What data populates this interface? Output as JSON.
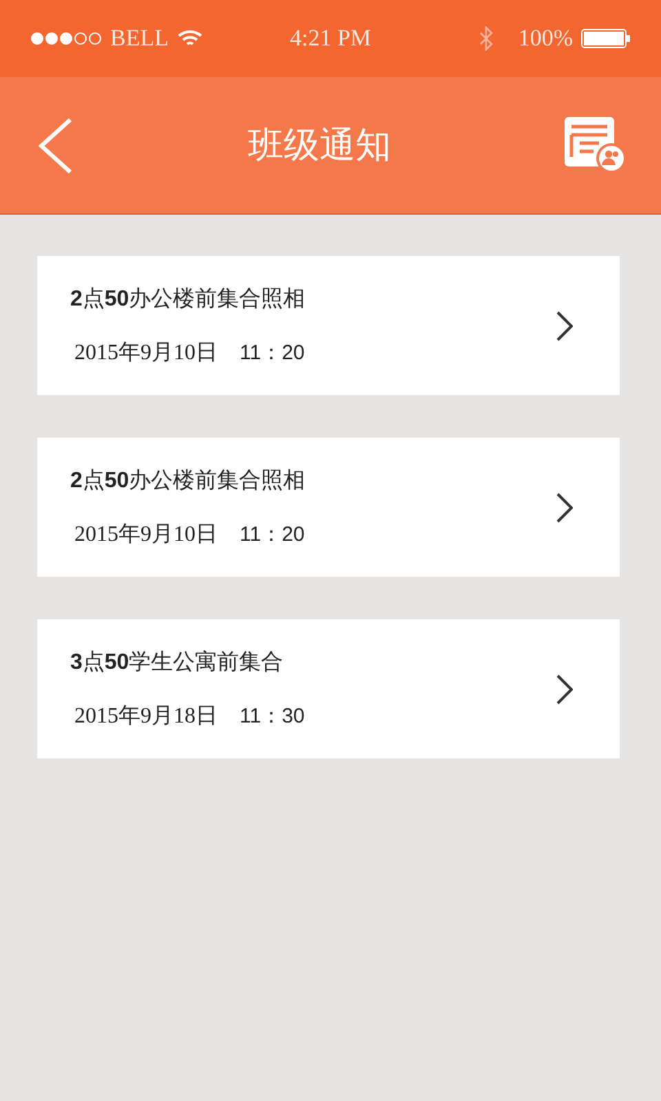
{
  "status_bar": {
    "carrier": "BELL",
    "time": "4:21 PM",
    "battery": "100%"
  },
  "header": {
    "title": "班级通知"
  },
  "notices": [
    {
      "title": "**2**点**50**办公楼前集合照相",
      "date": "2015年9月10日",
      "time": "11：20"
    },
    {
      "title": "**2**点**50**办公楼前集合照相",
      "date": "2015年9月10日",
      "time": "11：20"
    },
    {
      "title": "**3**点**50**学生公寓前集合",
      "date": "2015年9月18日",
      "time": "11：30"
    }
  ]
}
